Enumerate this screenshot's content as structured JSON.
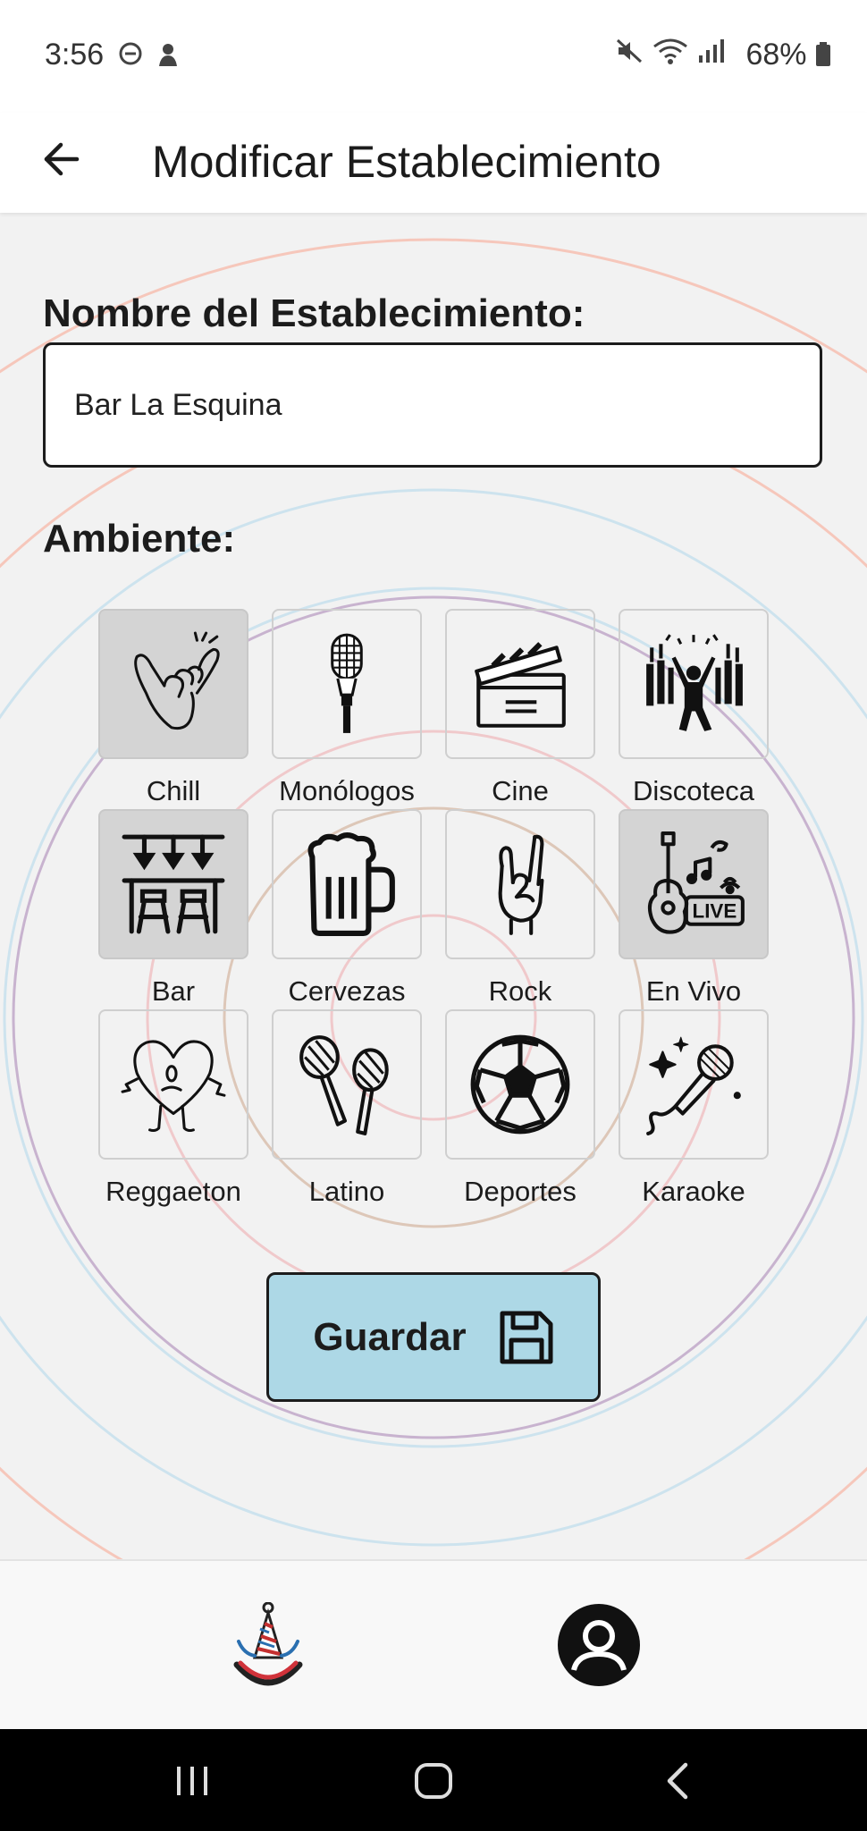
{
  "status_bar": {
    "time": "3:56",
    "battery": "68%"
  },
  "app_bar": {
    "title": "Modificar Establecimiento"
  },
  "form": {
    "name_label": "Nombre del Establecimiento:",
    "name_value": "Bar La Esquina",
    "ambiente_label": "Ambiente:"
  },
  "ambientes": [
    {
      "label": "Chill",
      "icon": "shaka-hand-icon",
      "selected": true
    },
    {
      "label": "Monólogos",
      "icon": "microphone-icon",
      "selected": false
    },
    {
      "label": "Cine",
      "icon": "clapperboard-icon",
      "selected": false
    },
    {
      "label": "Discoteca",
      "icon": "crowd-dancing-icon",
      "selected": false
    },
    {
      "label": "Bar",
      "icon": "bar-counter-icon",
      "selected": true
    },
    {
      "label": "Cervezas",
      "icon": "beer-mug-icon",
      "selected": false
    },
    {
      "label": "Rock",
      "icon": "rock-hand-icon",
      "selected": false
    },
    {
      "label": "En Vivo",
      "icon": "live-guitar-icon",
      "selected": true
    },
    {
      "label": "Reggaeton",
      "icon": "sad-heart-icon",
      "selected": false
    },
    {
      "label": "Latino",
      "icon": "maracas-icon",
      "selected": false
    },
    {
      "label": "Deportes",
      "icon": "soccer-ball-icon",
      "selected": false
    },
    {
      "label": "Karaoke",
      "icon": "karaoke-mic-icon",
      "selected": false
    }
  ],
  "save_button": {
    "label": "Guardar",
    "icon": "floppy-disk-icon"
  },
  "bottom_nav": {
    "home_icon": "party-hat-logo-icon",
    "profile_icon": "user-profile-icon"
  },
  "colors": {
    "save_button_bg": "#add8e6",
    "selected_tile_bg": "#d4d4d4"
  }
}
